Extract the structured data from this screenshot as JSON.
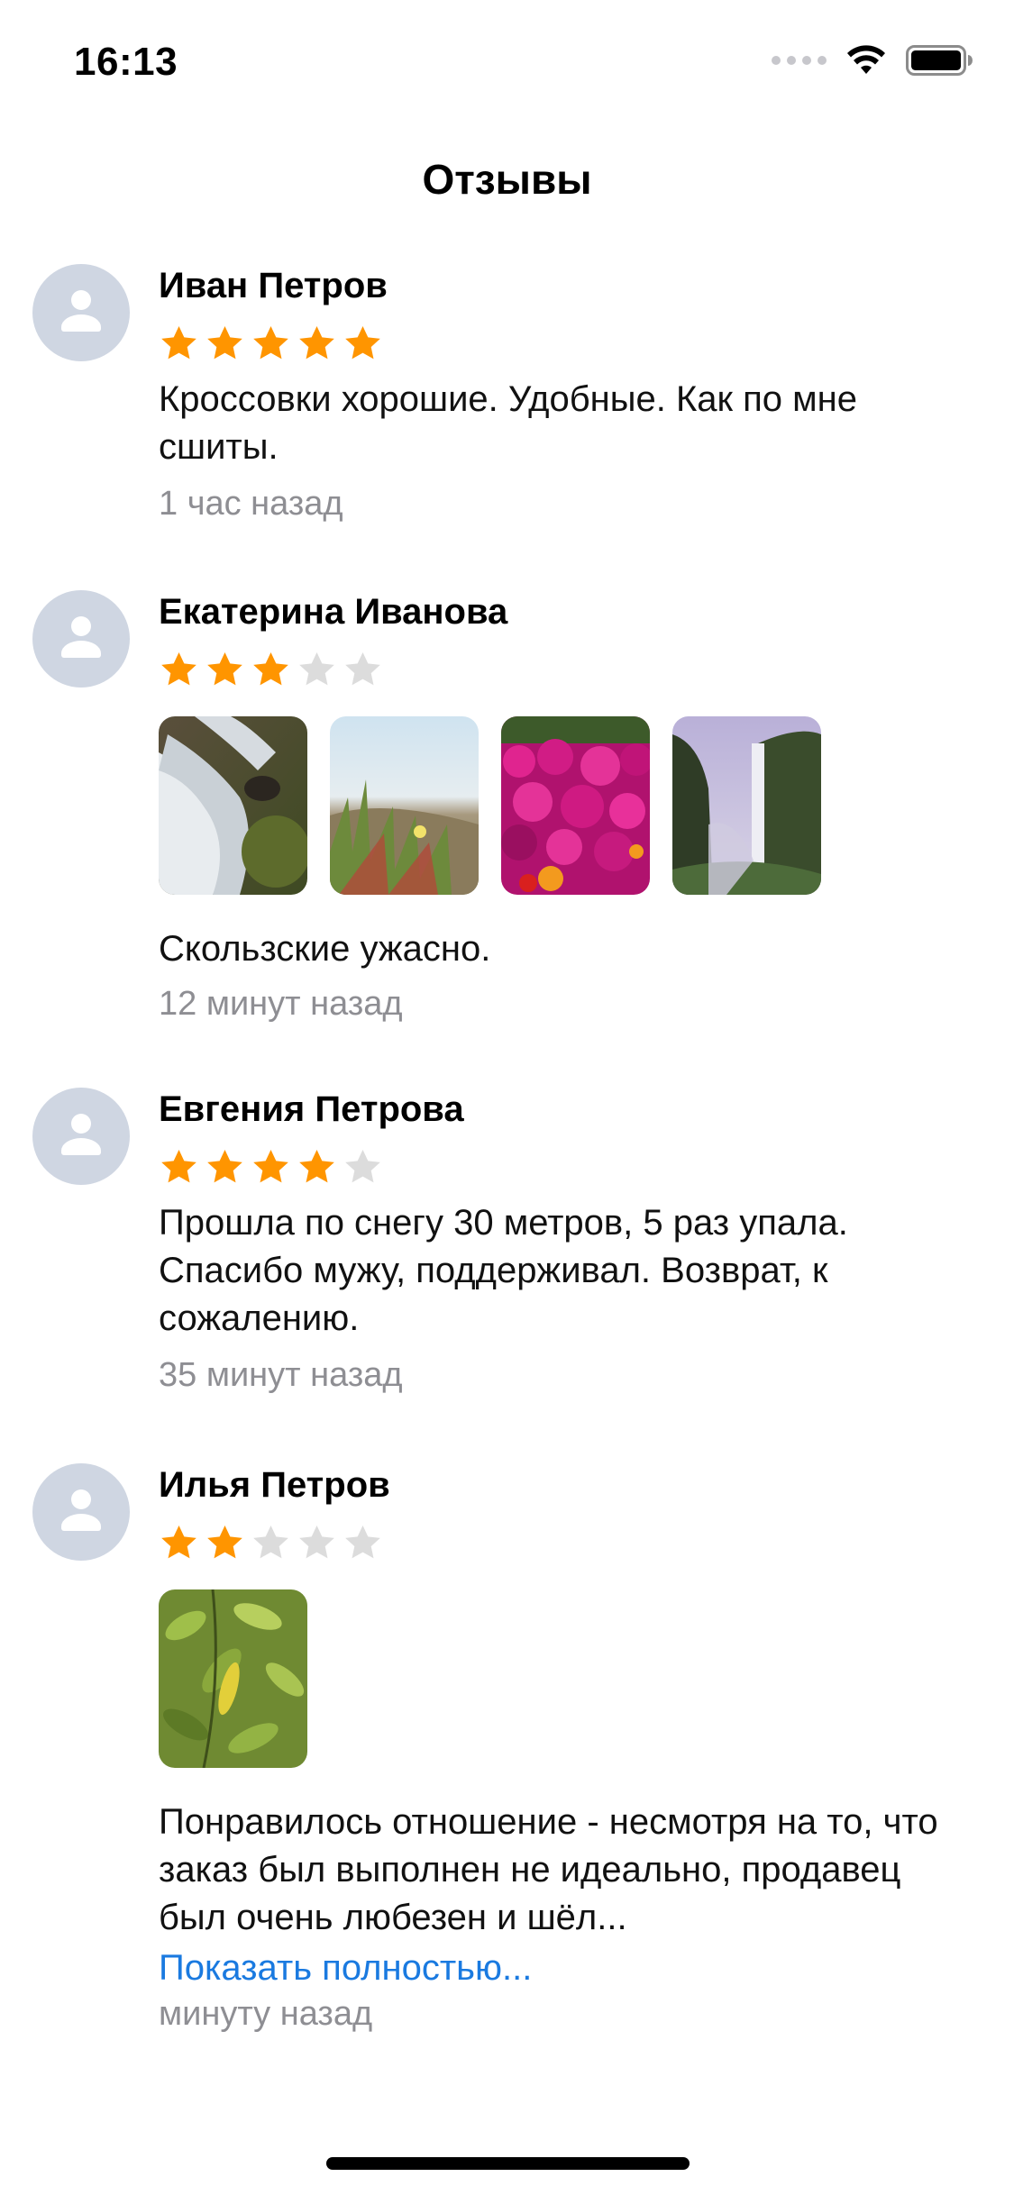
{
  "status_bar": {
    "time": "16:13"
  },
  "nav": {
    "title": "Отзывы"
  },
  "colors": {
    "star_filled": "#ff9500",
    "star_empty": "#dcdcdc",
    "link": "#1a7ae0",
    "secondary_text": "#8e8e93",
    "avatar_bg": "#cfd6e2"
  },
  "reviews": [
    {
      "author": "Иван Петров",
      "rating": 5,
      "text": "Кроссовки хорошие. Удобные. Как по мне сшиты.",
      "time": "1 час назад"
    },
    {
      "author": "Екатерина Иванова",
      "rating": 3,
      "photos": [
        "waterfall-rocks",
        "grass-dunes",
        "pink-flowers",
        "waterfall-cliff"
      ],
      "text": "Скользские ужасно.",
      "time": "12 минут назад"
    },
    {
      "author": "Евгения Петрова",
      "rating": 4,
      "text": "Прошла по снегу 30 метров, 5 раз упала. Спасибо мужу, поддерживал. Возврат, к сожалению.",
      "time": "35 минут назад"
    },
    {
      "author": "Илья Петров",
      "rating": 2,
      "photos": [
        "green-leaves"
      ],
      "text": "Понравилось отношение - несмотря на то, что заказ был выполнен не идеально, продавец был очень любезен и шёл...",
      "show_more": "Показать полностью...",
      "time": "минуту назад"
    }
  ]
}
